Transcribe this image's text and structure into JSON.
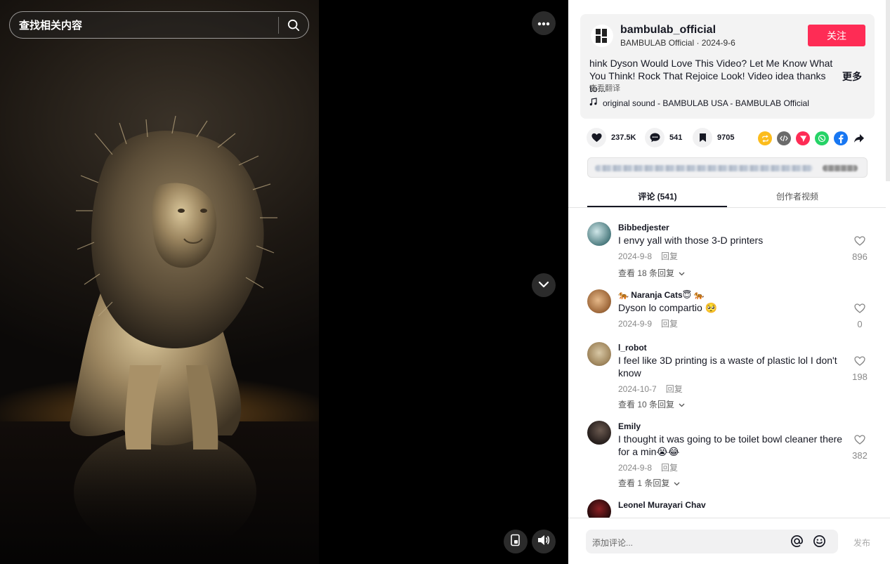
{
  "video": {
    "search_placeholder": "查找相关内容",
    "icons": {
      "search": "search-icon",
      "more": "more-dots-icon",
      "next": "chevron-down-icon",
      "pip": "picture-in-picture-icon",
      "volume": "volume-icon"
    }
  },
  "author": {
    "name": "bambulab_official",
    "subtitle": "BAMBULAB Official · 2024-9-6",
    "follow_label": "关注",
    "description": "hink Dyson Would Love This Video? Let Me Know What You Think! Rock That Rejoice Look! Video idea thanks to...",
    "more_label": "更多",
    "translate_label": "查看翻译",
    "sound": "original sound - BAMBULAB USA - BAMBULAB Official"
  },
  "actions": {
    "likes": "237.5K",
    "comments": "541",
    "saves": "9705",
    "share_targets": [
      "repost-icon",
      "embed-icon",
      "send-icon",
      "whatsapp-icon",
      "facebook-icon",
      "share-arrow-icon"
    ],
    "colors": {
      "repost": "#fcbc1c",
      "embed": "#6b6b6b",
      "send": "#fe2c55",
      "whatsapp": "#25d366",
      "facebook": "#1877f2"
    }
  },
  "tabs": [
    {
      "label": "评论 (541)",
      "active": true
    },
    {
      "label": "创作者视频",
      "active": false
    }
  ],
  "comments": [
    {
      "user": "Bibbedjester",
      "text": "I envy yall with those 3-D printers",
      "date": "2024-9-8",
      "reply": "回复",
      "likes": "896",
      "view_replies": "查看 18 条回复"
    },
    {
      "user": "🐅 Naranja Cats😇 🐅",
      "text": "Dyson lo compartio 🥺",
      "date": "2024-9-9",
      "reply": "回复",
      "likes": "0",
      "view_replies": ""
    },
    {
      "user": "l_robot",
      "text": "I feel like 3D printing is a waste of plastic lol I don't know",
      "date": "2024-10-7",
      "reply": "回复",
      "likes": "198",
      "view_replies": "查看 10 条回复"
    },
    {
      "user": "Emily",
      "text": "I thought it was going to be toilet bowl cleaner there for a min😭😂",
      "date": "2024-9-8",
      "reply": "回复",
      "likes": "382",
      "view_replies": "查看 1 条回复"
    },
    {
      "user": "Leonel Murayari Chav",
      "text": "",
      "date": "",
      "reply": "",
      "likes": "",
      "view_replies": ""
    }
  ],
  "composer": {
    "placeholder": "添加评论...",
    "post_label": "发布"
  },
  "theme": {
    "accent": "#fe2c55",
    "text": "#161823"
  }
}
